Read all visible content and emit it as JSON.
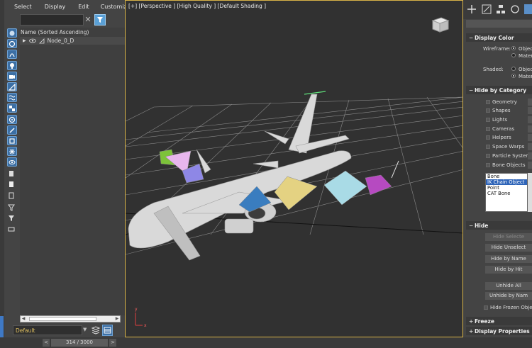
{
  "scene_explorer": {
    "menu": [
      "Select",
      "Display",
      "Edit",
      "Customize"
    ],
    "column_header": "Name (Sorted Ascending)",
    "node": "Node_0_D",
    "layer": "Default",
    "tool_icons": [
      "display-all-icon",
      "geometry-icon",
      "shapes-icon",
      "lights-icon",
      "cameras-icon",
      "helpers-icon",
      "space-warps-icon",
      "groups-icon",
      "xrefs-icon",
      "bones-icon",
      "containers-icon",
      "frozen-icon",
      "hidden-icon",
      "display-icon",
      "selection-icon",
      "children-icon",
      "dependents-icon",
      "filter-icon",
      "funnel-icon",
      "layer-icon"
    ]
  },
  "viewport": {
    "label": "[+] [Perspective ] [High Quality ] [Default Shading ]",
    "border_color": "#d8b348",
    "axis_labels": [
      "y",
      "x"
    ]
  },
  "time_slider": {
    "value": "314 / 3000",
    "prev": "<",
    "next": ">"
  },
  "command_panel": {
    "display_color": {
      "title": "Display Color",
      "wireframe_label": "Wireframe:",
      "shaded_label": "Shaded:",
      "options": [
        "Object",
        "Mater"
      ]
    },
    "hide_by_category": {
      "title": "Hide by Category",
      "items": [
        "Geometry",
        "Shapes",
        "Lights",
        "Cameras",
        "Helpers",
        "Space Warps",
        "Particle Systems",
        "Bone Objects"
      ],
      "list": [
        "Bone",
        "IK Chain Object",
        "Point",
        "CAT Bone"
      ],
      "selected": "IK Chain Object"
    },
    "hide": {
      "title": "Hide",
      "buttons": [
        "Hide Selecte",
        "Hide Unselect",
        "Hide by Name",
        "Hide by Hit",
        "Unhide All",
        "Unhide by Nam"
      ],
      "frozen_label": "Hide Frozen Objec"
    },
    "freeze": {
      "title": "Freeze"
    },
    "display_properties": {
      "title": "Display Properties"
    },
    "sign": "+",
    "sign_open": "−"
  }
}
